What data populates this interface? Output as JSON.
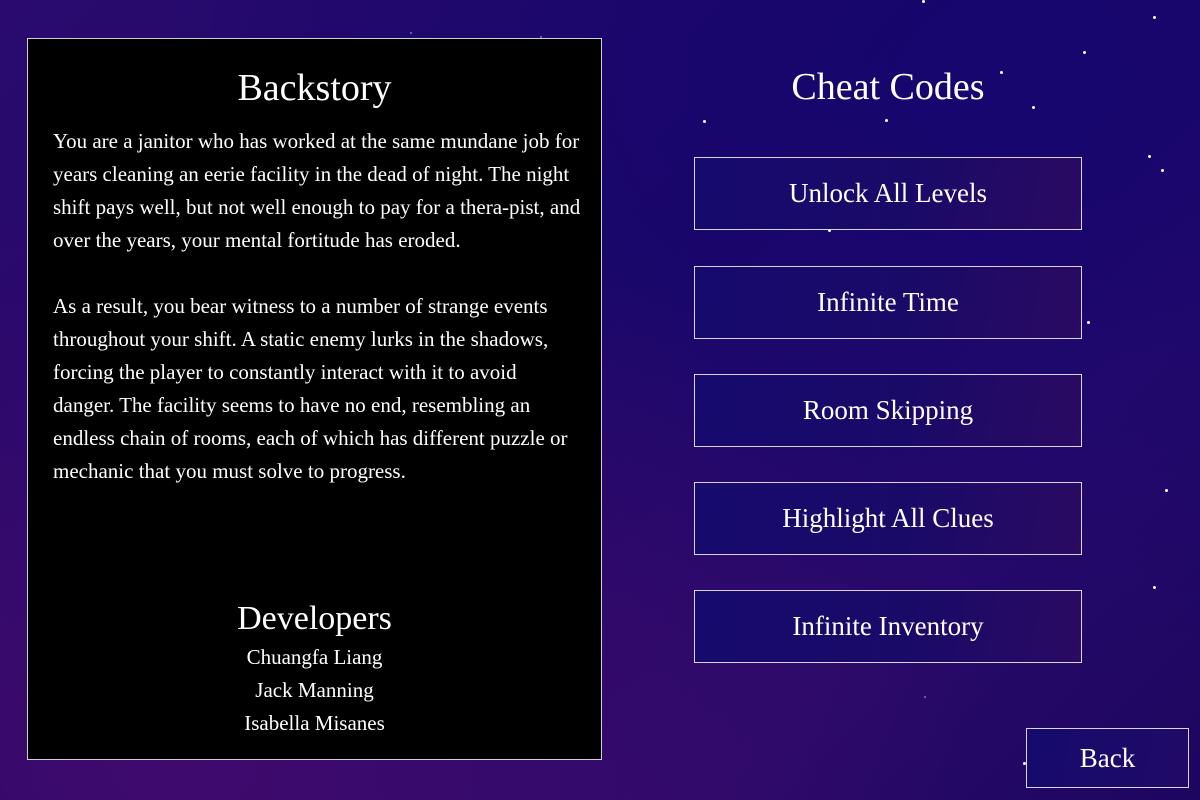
{
  "backstory": {
    "title": "Backstory",
    "paragraphs": [
      "You are a janitor who has worked at the same mundane job for years cleaning an eerie facility in the dead of night. The night shift pays well, but not well enough to pay for a thera-pist, and over the years, your mental fortitude has eroded.",
      "As a result, you bear witness to a number of strange events throughout your shift. A static enemy lurks in the shadows, forcing the player to constantly interact with it to avoid danger. The facility seems to have no end, resembling an endless chain of rooms, each of which has different puzzle or mechanic that you must solve to progress."
    ]
  },
  "developers": {
    "title": "Developers",
    "names": [
      "Chuangfa Liang",
      "Jack Manning",
      "Isabella Misanes"
    ]
  },
  "cheats": {
    "title": "Cheat Codes",
    "buttons": [
      "Unlock All Levels",
      "Infinite Time",
      "Room Skipping",
      "Highlight All Clues",
      "Infinite Inventory"
    ]
  },
  "nav": {
    "back_label": "Back"
  },
  "colors": {
    "background": "#1e0868",
    "panel": "#000000",
    "button_fill": "#160a6e",
    "border": "#d8d4ea",
    "text": "#ffffff"
  }
}
